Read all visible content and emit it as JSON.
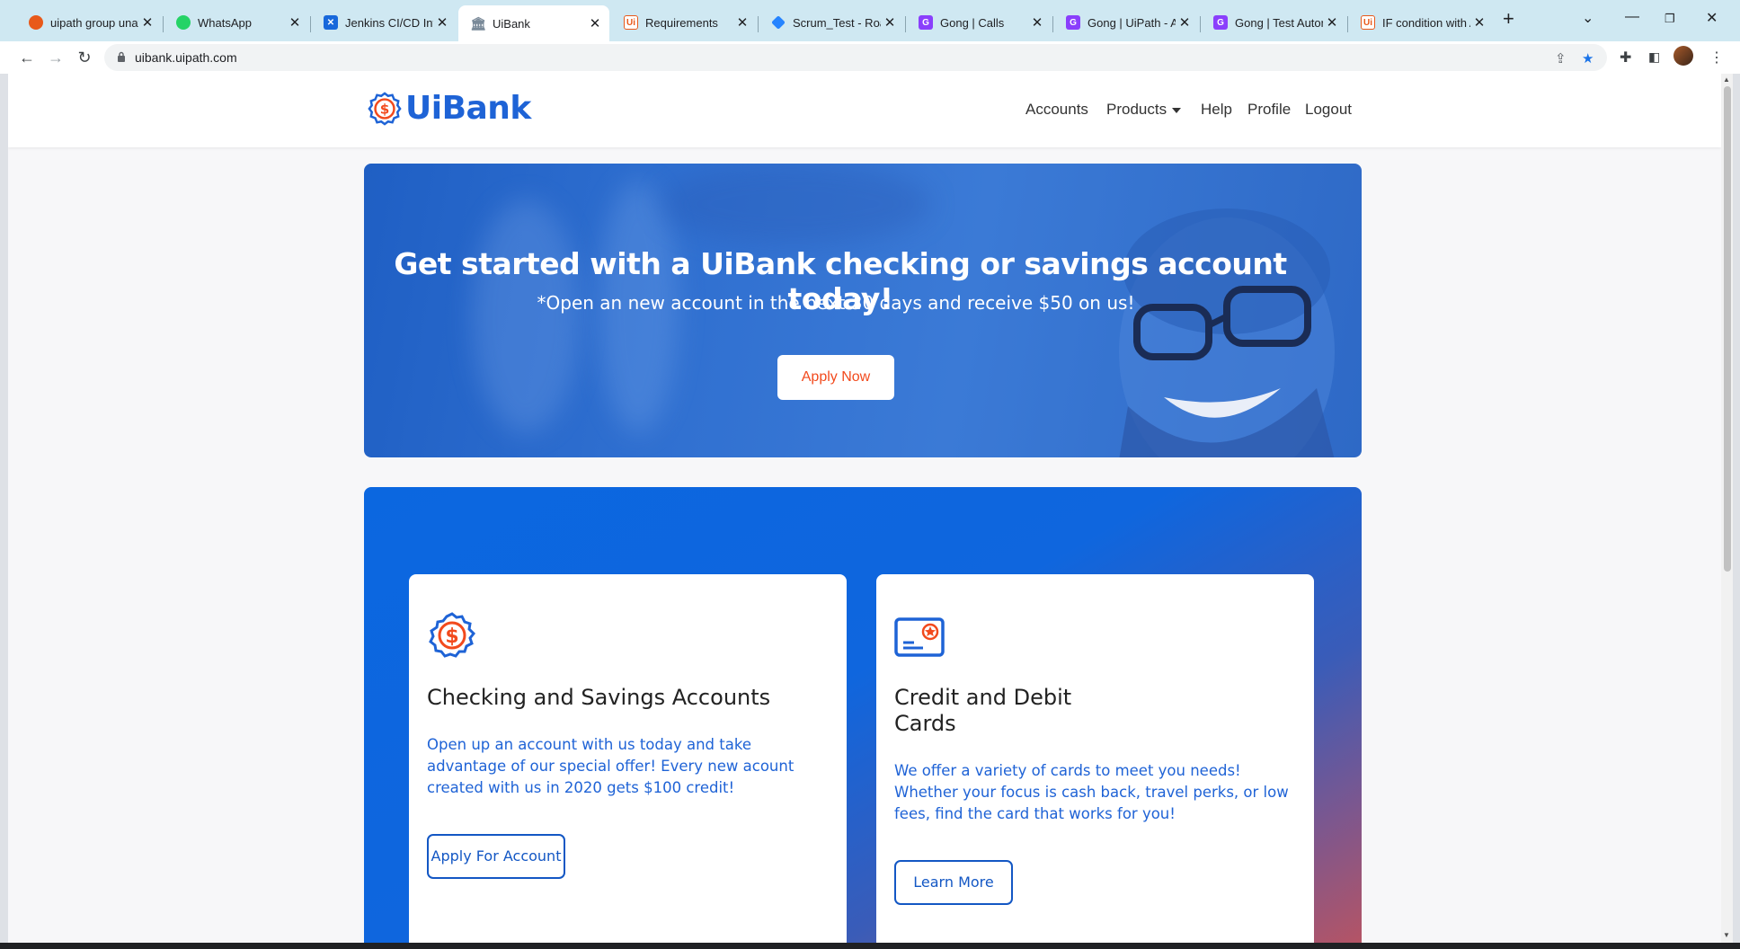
{
  "browser": {
    "tabs": [
      {
        "title": "uipath group unattended",
        "favicon": "uipath-orange-icon",
        "color": "#e8591a"
      },
      {
        "title": "WhatsApp",
        "favicon": "whatsapp-icon",
        "color": "#25d366"
      },
      {
        "title": "Jenkins CI/CD Integration",
        "favicon": "confluence-icon",
        "color": "#1868db"
      },
      {
        "title": "UiBank",
        "favicon": "bank-icon",
        "color": "#7a8a99",
        "active": true
      },
      {
        "title": "Requirements",
        "favicon": "uipath-ui-icon",
        "color": "#e8591a"
      },
      {
        "title": "Scrum_Test - Roadmap",
        "favicon": "jira-icon",
        "color": "#2684ff"
      },
      {
        "title": "Gong | Calls",
        "favicon": "gong-icon",
        "color": "#8a3ffc"
      },
      {
        "title": "Gong | UiPath - Account",
        "favicon": "gong-icon",
        "color": "#8a3ffc"
      },
      {
        "title": "Gong | Test Automation",
        "favicon": "gong-icon",
        "color": "#8a3ffc"
      },
      {
        "title": "IF condition with And",
        "favicon": "uipath-ui-icon",
        "color": "#e8591a"
      }
    ],
    "url": "uibank.uipath.com"
  },
  "site": {
    "brand": "UiBank",
    "nav": {
      "accounts": "Accounts",
      "products": "Products",
      "help": "Help",
      "profile": "Profile",
      "logout": "Logout"
    }
  },
  "hero": {
    "title": "Get started with a UiBank checking or savings account today!",
    "subtitle": "*Open an new account in the next 30 days and receive $50 on us!",
    "cta": "Apply Now"
  },
  "cards": [
    {
      "title": "Checking and Savings Accounts",
      "text": "Open up an account with us today and take advantage of our special offer! Every new acount created with us in 2020 gets $100 credit!",
      "button": "Apply For Account",
      "icon": "dollar-badge-icon"
    },
    {
      "title": "Credit and Debit Cards",
      "text": "We offer a variety of cards to meet you needs! Whether your focus is cash back, travel perks, or low fees, find the card that works for you!",
      "button": "Learn More",
      "icon": "credit-card-star-icon"
    }
  ],
  "colors": {
    "brand_blue": "#1e63d6",
    "accent_orange": "#f24a1d"
  }
}
